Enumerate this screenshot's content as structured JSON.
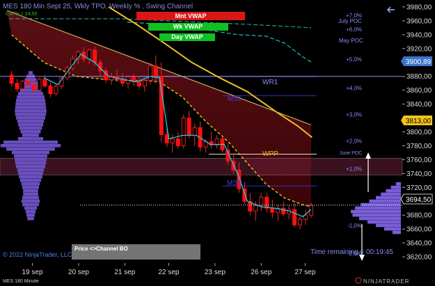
{
  "header": {
    "title": "MES 180 Min Sept 25, Wkly TPO, Weekly % , Swing Channel",
    "vol_text": "0,67% = 24,50"
  },
  "vwap_buttons": [
    {
      "label": "Mnt VWAP",
      "color": "#d81818"
    },
    {
      "label": "Wk VWAP",
      "color": "#10c020"
    },
    {
      "label": "Day VWAP",
      "color": "#10c020"
    }
  ],
  "pct_labels": [
    "+7,0%",
    "+6,0%",
    "+5,0%",
    "+4,0%",
    "+3,0%",
    "+2,0%",
    "+1,0%",
    "-1,0%",
    "-2,0%"
  ],
  "level_labels": {
    "july_poc": "July POC",
    "may_poc": "May POC",
    "wr1": "WR1",
    "ms1": "MS1",
    "wpp": "WPP",
    "june_poc": "June POC",
    "msp": "MSP"
  },
  "price_badges": [
    {
      "value": "3900,89",
      "bg": "#3a74c8",
      "fg": "#ffffff"
    },
    {
      "value": "3813,00",
      "bg": "#f3c21a",
      "fg": "#000000"
    },
    {
      "value": "3694,50",
      "bg": "#000000",
      "fg": "#ffffff"
    }
  ],
  "footer": {
    "copyright": "© 2022 NinjaTrader, LLC",
    "channel_label": "Price <>Channel BO",
    "time_remaining": "Time remaining = 00:19:45",
    "instrument": "MES 180 Minute",
    "brand": "NINJATRADER"
  },
  "chart_data": {
    "type": "candlestick",
    "y_ticks": [
      3980,
      3960,
      3940,
      3920,
      3900,
      3880,
      3860,
      3840,
      3820,
      3800,
      3780,
      3760,
      3740,
      3720,
      3700,
      3680,
      3660,
      3640,
      3620
    ],
    "ylim": [
      3605,
      3990
    ],
    "x_labels": [
      "19 sep",
      "20 sep",
      "21 sep",
      "22 sep",
      "23 sep",
      "26 sep",
      "27 sep"
    ],
    "x_domain": [
      0,
      7
    ],
    "x_label_pos": [
      0.55,
      1.55,
      2.55,
      3.5,
      4.5,
      5.5,
      6.45
    ],
    "candles": [
      {
        "x": 0.1,
        "o": 3882,
        "h": 3888,
        "l": 3865,
        "c": 3870
      },
      {
        "x": 0.22,
        "o": 3870,
        "h": 3876,
        "l": 3858,
        "c": 3862
      },
      {
        "x": 0.34,
        "o": 3862,
        "h": 3875,
        "l": 3857,
        "c": 3873
      },
      {
        "x": 0.46,
        "o": 3873,
        "h": 3882,
        "l": 3866,
        "c": 3868
      },
      {
        "x": 0.58,
        "o": 3868,
        "h": 3875,
        "l": 3855,
        "c": 3860
      },
      {
        "x": 0.7,
        "o": 3860,
        "h": 3878,
        "l": 3858,
        "c": 3876
      },
      {
        "x": 0.82,
        "o": 3876,
        "h": 3882,
        "l": 3864,
        "c": 3866
      },
      {
        "x": 0.94,
        "o": 3866,
        "h": 3872,
        "l": 3850,
        "c": 3855
      },
      {
        "x": 1.06,
        "o": 3855,
        "h": 3870,
        "l": 3852,
        "c": 3866
      },
      {
        "x": 1.18,
        "o": 3866,
        "h": 3880,
        "l": 3862,
        "c": 3878
      },
      {
        "x": 1.3,
        "o": 3878,
        "h": 3895,
        "l": 3874,
        "c": 3892
      },
      {
        "x": 1.42,
        "o": 3892,
        "h": 3910,
        "l": 3888,
        "c": 3905
      },
      {
        "x": 1.54,
        "o": 3905,
        "h": 3918,
        "l": 3898,
        "c": 3915
      },
      {
        "x": 1.66,
        "o": 3915,
        "h": 3922,
        "l": 3900,
        "c": 3905
      },
      {
        "x": 1.78,
        "o": 3905,
        "h": 3920,
        "l": 3898,
        "c": 3918
      },
      {
        "x": 1.9,
        "o": 3918,
        "h": 3923,
        "l": 3895,
        "c": 3900
      },
      {
        "x": 2.02,
        "o": 3900,
        "h": 3905,
        "l": 3880,
        "c": 3888
      },
      {
        "x": 2.14,
        "o": 3888,
        "h": 3892,
        "l": 3870,
        "c": 3875
      },
      {
        "x": 2.26,
        "o": 3875,
        "h": 3885,
        "l": 3868,
        "c": 3880
      },
      {
        "x": 2.38,
        "o": 3880,
        "h": 3890,
        "l": 3872,
        "c": 3876
      },
      {
        "x": 2.5,
        "o": 3876,
        "h": 3885,
        "l": 3865,
        "c": 3870
      },
      {
        "x": 2.62,
        "o": 3870,
        "h": 3882,
        "l": 3862,
        "c": 3879
      },
      {
        "x": 2.74,
        "o": 3879,
        "h": 3884,
        "l": 3866,
        "c": 3872
      },
      {
        "x": 2.86,
        "o": 3872,
        "h": 3880,
        "l": 3862,
        "c": 3866
      },
      {
        "x": 2.98,
        "o": 3866,
        "h": 3878,
        "l": 3858,
        "c": 3874
      },
      {
        "x": 3.1,
        "o": 3874,
        "h": 3900,
        "l": 3868,
        "c": 3895
      },
      {
        "x": 3.22,
        "o": 3895,
        "h": 3910,
        "l": 3870,
        "c": 3880
      },
      {
        "x": 3.34,
        "o": 3880,
        "h": 3900,
        "l": 3785,
        "c": 3796
      },
      {
        "x": 3.46,
        "o": 3796,
        "h": 3805,
        "l": 3778,
        "c": 3784
      },
      {
        "x": 3.58,
        "o": 3784,
        "h": 3796,
        "l": 3770,
        "c": 3790
      },
      {
        "x": 3.7,
        "o": 3790,
        "h": 3800,
        "l": 3776,
        "c": 3780
      },
      {
        "x": 3.82,
        "o": 3780,
        "h": 3825,
        "l": 3776,
        "c": 3820
      },
      {
        "x": 3.94,
        "o": 3820,
        "h": 3830,
        "l": 3790,
        "c": 3795
      },
      {
        "x": 4.06,
        "o": 3795,
        "h": 3812,
        "l": 3780,
        "c": 3806
      },
      {
        "x": 4.18,
        "o": 3806,
        "h": 3815,
        "l": 3772,
        "c": 3778
      },
      {
        "x": 4.3,
        "o": 3778,
        "h": 3790,
        "l": 3770,
        "c": 3786
      },
      {
        "x": 4.42,
        "o": 3786,
        "h": 3800,
        "l": 3776,
        "c": 3781
      },
      {
        "x": 4.54,
        "o": 3781,
        "h": 3795,
        "l": 3776,
        "c": 3790
      },
      {
        "x": 4.66,
        "o": 3790,
        "h": 3796,
        "l": 3770,
        "c": 3774
      },
      {
        "x": 4.78,
        "o": 3774,
        "h": 3784,
        "l": 3752,
        "c": 3758
      },
      {
        "x": 4.9,
        "o": 3758,
        "h": 3770,
        "l": 3740,
        "c": 3745
      },
      {
        "x": 5.02,
        "o": 3745,
        "h": 3756,
        "l": 3712,
        "c": 3718
      },
      {
        "x": 5.14,
        "o": 3718,
        "h": 3728,
        "l": 3696,
        "c": 3700
      },
      {
        "x": 5.26,
        "o": 3700,
        "h": 3712,
        "l": 3680,
        "c": 3686
      },
      {
        "x": 5.38,
        "o": 3686,
        "h": 3700,
        "l": 3672,
        "c": 3694
      },
      {
        "x": 5.5,
        "o": 3694,
        "h": 3712,
        "l": 3686,
        "c": 3706
      },
      {
        "x": 5.62,
        "o": 3706,
        "h": 3712,
        "l": 3684,
        "c": 3690
      },
      {
        "x": 5.74,
        "o": 3690,
        "h": 3702,
        "l": 3676,
        "c": 3684
      },
      {
        "x": 5.86,
        "o": 3684,
        "h": 3695,
        "l": 3672,
        "c": 3690
      },
      {
        "x": 5.98,
        "o": 3690,
        "h": 3700,
        "l": 3678,
        "c": 3682
      },
      {
        "x": 6.1,
        "o": 3682,
        "h": 3694,
        "l": 3674,
        "c": 3688
      },
      {
        "x": 6.22,
        "o": 3688,
        "h": 3698,
        "l": 3662,
        "c": 3666
      },
      {
        "x": 6.34,
        "o": 3666,
        "h": 3678,
        "l": 3660,
        "c": 3674
      },
      {
        "x": 6.46,
        "o": 3674,
        "h": 3688,
        "l": 3666,
        "c": 3680
      },
      {
        "x": 6.58,
        "o": 3680,
        "h": 3698,
        "l": 3676,
        "c": 3694
      }
    ],
    "profile_left": [
      [
        3885,
        5
      ],
      [
        3880,
        10
      ],
      [
        3875,
        14
      ],
      [
        3870,
        18
      ],
      [
        3865,
        22
      ],
      [
        3860,
        25
      ],
      [
        3855,
        30
      ],
      [
        3850,
        33
      ],
      [
        3845,
        35
      ],
      [
        3840,
        36
      ],
      [
        3835,
        37
      ],
      [
        3830,
        38
      ],
      [
        3825,
        37
      ],
      [
        3820,
        35
      ],
      [
        3815,
        32
      ],
      [
        3810,
        30
      ],
      [
        3805,
        27
      ],
      [
        3800,
        24
      ],
      [
        3795,
        20
      ],
      [
        3790,
        30
      ],
      [
        3785,
        65
      ],
      [
        3780,
        72
      ],
      [
        3775,
        58
      ],
      [
        3770,
        45
      ],
      [
        3765,
        40
      ],
      [
        3760,
        38
      ],
      [
        3755,
        37
      ],
      [
        3750,
        35
      ],
      [
        3745,
        32
      ],
      [
        3740,
        30
      ],
      [
        3735,
        28
      ],
      [
        3730,
        25
      ],
      [
        3725,
        22
      ],
      [
        3720,
        20
      ],
      [
        3715,
        18
      ],
      [
        3710,
        18
      ],
      [
        3705,
        20
      ],
      [
        3700,
        22
      ],
      [
        3695,
        20
      ],
      [
        3690,
        15
      ],
      [
        3685,
        12
      ],
      [
        3680,
        10
      ],
      [
        3675,
        8
      ]
    ],
    "profile_right": [
      [
        3725,
        6
      ],
      [
        3720,
        12
      ],
      [
        3715,
        18
      ],
      [
        3710,
        24
      ],
      [
        3705,
        30
      ],
      [
        3700,
        38
      ],
      [
        3695,
        48
      ],
      [
        3690,
        55
      ],
      [
        3685,
        60
      ],
      [
        3680,
        58
      ],
      [
        3675,
        50
      ],
      [
        3670,
        40
      ],
      [
        3665,
        30
      ],
      [
        3660,
        20
      ],
      [
        3655,
        10
      ]
    ],
    "wk_vwap": [
      [
        0.1,
        3940
      ],
      [
        0.8,
        3900
      ],
      [
        1.5,
        3880
      ],
      [
        2.2,
        3875
      ],
      [
        2.6,
        3874
      ],
      [
        3.0,
        3874
      ],
      [
        3.3,
        3872
      ],
      [
        3.8,
        3850
      ],
      [
        4.3,
        3815
      ],
      [
        4.8,
        3785
      ],
      [
        5.2,
        3755
      ],
      [
        5.6,
        3725
      ],
      [
        6.0,
        3705
      ],
      [
        6.4,
        3695
      ],
      [
        6.58,
        3692
      ]
    ],
    "month_vwap": [
      [
        2.2,
        3980
      ],
      [
        2.8,
        3955
      ],
      [
        3.4,
        3928
      ],
      [
        4.0,
        3900
      ],
      [
        4.6,
        3878
      ],
      [
        5.2,
        3858
      ],
      [
        5.8,
        3830
      ],
      [
        6.3,
        3808
      ],
      [
        6.6,
        3792
      ]
    ],
    "day_vwap": [
      [
        2.6,
        3958
      ],
      [
        3.4,
        3955
      ],
      [
        4.2,
        3948
      ],
      [
        5.0,
        3940
      ],
      [
        5.6,
        3938
      ],
      [
        6.0,
        3928
      ],
      [
        6.4,
        3908
      ],
      [
        6.6,
        3900
      ]
    ],
    "fast_ma": [
      [
        0.8,
        3878
      ],
      [
        1.1,
        3868
      ],
      [
        1.4,
        3895
      ],
      [
        1.6,
        3912
      ],
      [
        1.9,
        3900
      ],
      [
        2.2,
        3880
      ],
      [
        2.5,
        3876
      ],
      [
        2.8,
        3872
      ],
      [
        3.1,
        3880
      ],
      [
        3.3,
        3878
      ],
      [
        3.5,
        3790
      ],
      [
        3.8,
        3795
      ],
      [
        4.1,
        3795
      ],
      [
        4.4,
        3782
      ],
      [
        4.7,
        3782
      ],
      [
        5.0,
        3738
      ],
      [
        5.2,
        3700
      ],
      [
        5.5,
        3692
      ],
      [
        5.8,
        3690
      ],
      [
        6.1,
        3686
      ],
      [
        6.4,
        3678
      ],
      [
        6.58,
        3688
      ]
    ],
    "lvn_line": [
      [
        0.05,
        3963
      ],
      [
        1.8,
        3963
      ],
      [
        2.4,
        3963
      ],
      [
        3.5,
        3960
      ],
      [
        4.5,
        3957
      ],
      [
        5.5,
        3954
      ],
      [
        6.58,
        3950
      ]
    ],
    "channel_top": [
      [
        0,
        3975
      ],
      [
        6.58,
        3810
      ]
    ],
    "h_levels": [
      {
        "key": "wr1",
        "price": 3880
      },
      {
        "key": "ms1",
        "price": 3852
      },
      {
        "key": "wpp",
        "price": 3768
      },
      {
        "key": "msp",
        "price": 3722
      }
    ],
    "band": [
      3738,
      3762
    ],
    "current_price": 3694.5,
    "pct_prices": [
      3968,
      3948,
      3905,
      3863,
      3825,
      3787,
      3747,
      3665,
      3625
    ]
  }
}
